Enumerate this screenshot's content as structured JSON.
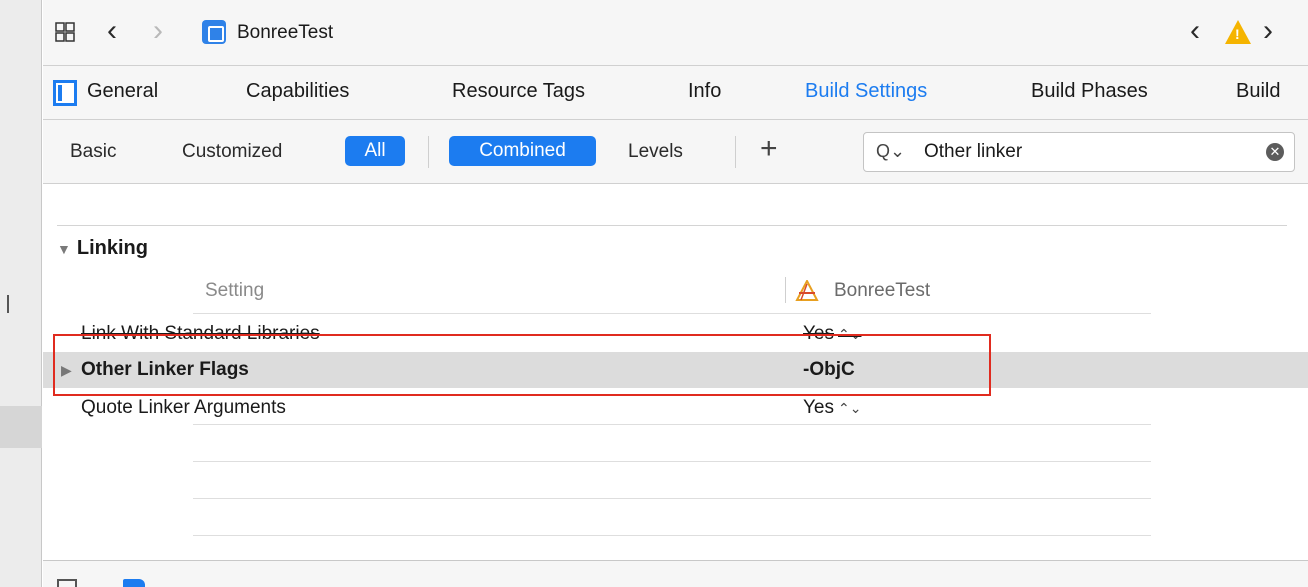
{
  "navbar": {
    "title": "BonreeTest",
    "back_glyph": "‹",
    "forward_glyph": "›"
  },
  "tabs": [
    {
      "label": "General",
      "active": false
    },
    {
      "label": "Capabilities",
      "active": false
    },
    {
      "label": "Resource Tags",
      "active": false
    },
    {
      "label": "Info",
      "active": false
    },
    {
      "label": "Build Settings",
      "active": true
    },
    {
      "label": "Build Phases",
      "active": false
    },
    {
      "label": "Build",
      "active": false
    }
  ],
  "filter": {
    "basic": "Basic",
    "customized": "Customized",
    "all": "All",
    "combined": "Combined",
    "levels": "Levels",
    "plus": "+"
  },
  "search": {
    "value": "Other linker",
    "icon_glyph": "Q⌄"
  },
  "section": {
    "title": "Linking",
    "column_setting": "Setting",
    "column_target": "BonreeTest"
  },
  "rows": [
    {
      "name": "Link With Standard Libraries",
      "value": "Yes",
      "stepper": "⌃⌄"
    },
    {
      "name": "Other Linker Flags",
      "value": "-ObjC",
      "stepper": ""
    },
    {
      "name": "Quote Linker Arguments",
      "value": "Yes",
      "stepper": "⌃⌄"
    }
  ],
  "colors": {
    "accent": "#1c7cf0",
    "highlight": "#e02b1f",
    "warning": "#f5b400"
  }
}
